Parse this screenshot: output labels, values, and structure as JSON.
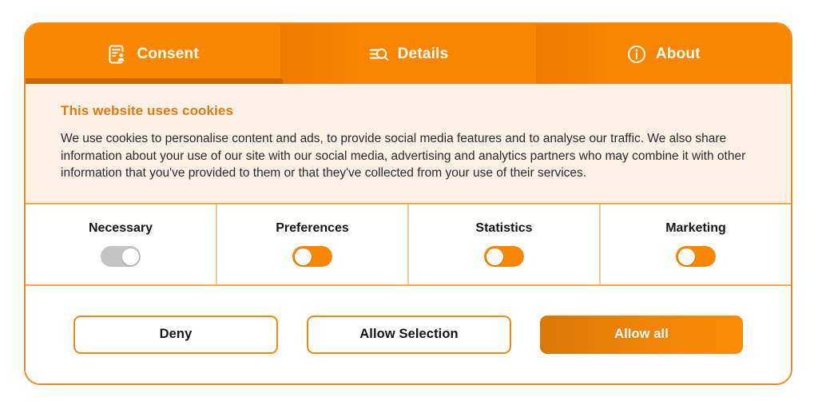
{
  "banner": {
    "tabs": [
      {
        "label": "Consent",
        "icon": "consent-document-person-icon",
        "active": true
      },
      {
        "label": "Details",
        "icon": "details-list-search-icon",
        "active": false
      },
      {
        "label": "About",
        "icon": "about-info-circle-icon",
        "active": false
      }
    ],
    "intro": {
      "title": "This website uses cookies",
      "body": "We use cookies to personalise content and ads, to provide social media features and to analyse our traffic. We also share information about your use of our site with our social media, advertising and analytics partners who may combine it with other information that you've provided to them or that they've collected from your use of their services."
    },
    "categories": [
      {
        "label": "Necessary",
        "state": "locked-on",
        "knob": "right"
      },
      {
        "label": "Preferences",
        "state": "off",
        "knob": "left"
      },
      {
        "label": "Statistics",
        "state": "off",
        "knob": "left"
      },
      {
        "label": "Marketing",
        "state": "off",
        "knob": "left"
      }
    ],
    "buttons": {
      "deny": "Deny",
      "allow_selection": "Allow Selection",
      "allow_all": "Allow all"
    },
    "colors": {
      "brand_orange": "#F98700",
      "dark_orange": "#C86A04",
      "border_orange": "#F18A17",
      "divider_orange": "#FBC88A",
      "cream_bg": "#FDF1E6",
      "title_orange": "#E07A10",
      "toggle_off_gray": "#C4C4C4",
      "text_dark": "#2B2B2B"
    }
  }
}
